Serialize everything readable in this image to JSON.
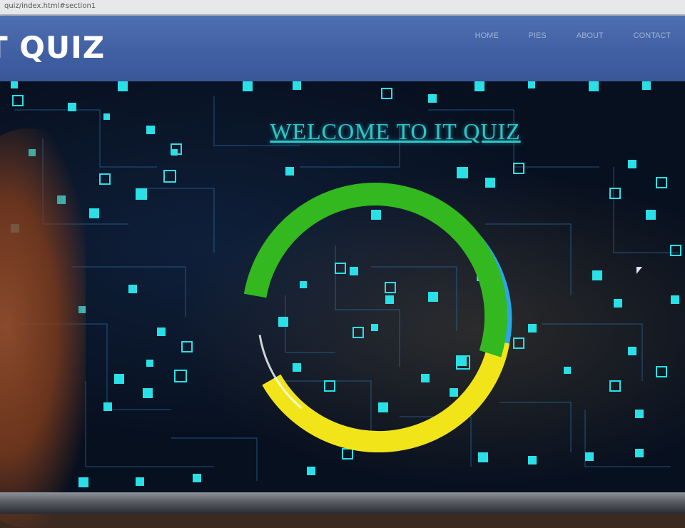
{
  "browser": {
    "url_fragment": "quiz/index.html#section1"
  },
  "navbar": {
    "brand": "T QUIZ",
    "links": [
      "HOME",
      "PIES",
      "ABOUT",
      "CONTACT"
    ]
  },
  "hero": {
    "heading": "WELCOME TO IT QUIZ"
  },
  "colors": {
    "navbar": "#4467ac",
    "heading": "#2fc6c8",
    "ring_green": "#33b81f",
    "ring_yellow": "#f1e51a",
    "ring_blue": "#2aa6ea",
    "ring_orange": "#f07a24",
    "circuit": "#29e0e6"
  }
}
